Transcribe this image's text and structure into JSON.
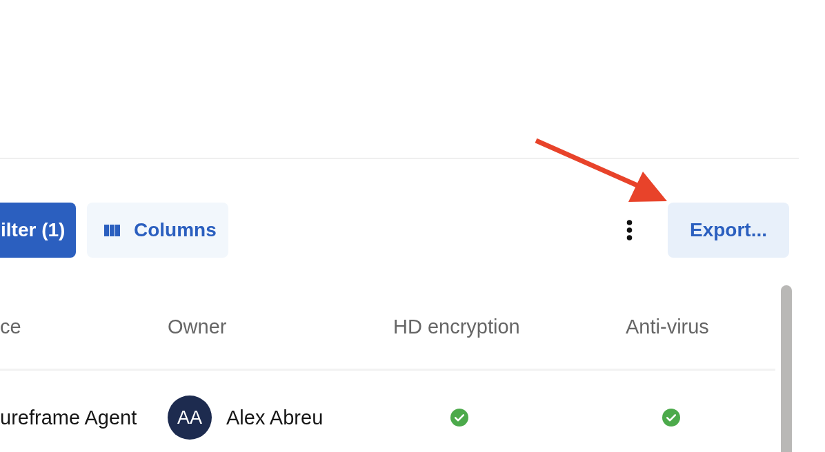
{
  "toolbar": {
    "filter_button": {
      "label": "ilter (1)"
    },
    "columns_button": {
      "label": "Columns"
    },
    "export_button": {
      "label": "Export..."
    }
  },
  "table": {
    "columns": [
      {
        "label": "ce",
        "kind": "text"
      },
      {
        "label": "Owner",
        "kind": "owner"
      },
      {
        "label": "HD encryption",
        "kind": "status"
      },
      {
        "label": "Anti-virus",
        "kind": "status"
      }
    ],
    "rows": [
      {
        "cells": [
          {
            "text": "ureframe Agent"
          },
          {
            "initials": "AA",
            "name": "Alex Abreu"
          },
          {
            "ok": true
          },
          {
            "ok": true
          }
        ]
      }
    ]
  }
}
